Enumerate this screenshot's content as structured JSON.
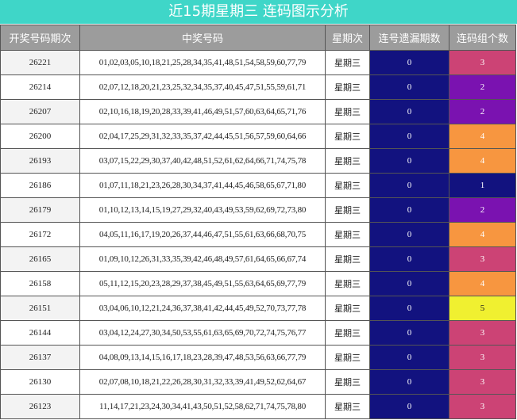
{
  "title": "近15期星期三 连码图示分析",
  "headers": [
    "开奖号码期次",
    "中奖号码",
    "星期次",
    "连号遗漏期数",
    "连码组个数"
  ],
  "rows": [
    {
      "period": "26221",
      "numbers": "01,02,03,05,10,18,21,25,28,34,35,41,48,51,54,58,59,60,77,79",
      "weekday": "星期三",
      "missed": "0",
      "groups": "3"
    },
    {
      "period": "26214",
      "numbers": "02,07,12,18,20,21,23,25,32,34,35,37,40,45,47,51,55,59,61,71",
      "weekday": "星期三",
      "missed": "0",
      "groups": "2"
    },
    {
      "period": "26207",
      "numbers": "02,10,16,18,19,20,28,33,39,41,46,49,51,57,60,63,64,65,71,76",
      "weekday": "星期三",
      "missed": "0",
      "groups": "2"
    },
    {
      "period": "26200",
      "numbers": "02,04,17,25,29,31,32,33,35,37,42,44,45,51,56,57,59,60,64,66",
      "weekday": "星期三",
      "missed": "0",
      "groups": "4"
    },
    {
      "period": "26193",
      "numbers": "03,07,15,22,29,30,37,40,42,48,51,52,61,62,64,66,71,74,75,78",
      "weekday": "星期三",
      "missed": "0",
      "groups": "4"
    },
    {
      "period": "26186",
      "numbers": "01,07,11,18,21,23,26,28,30,34,37,41,44,45,46,58,65,67,71,80",
      "weekday": "星期三",
      "missed": "0",
      "groups": "1"
    },
    {
      "period": "26179",
      "numbers": "01,10,12,13,14,15,19,27,29,32,40,43,49,53,59,62,69,72,73,80",
      "weekday": "星期三",
      "missed": "0",
      "groups": "2"
    },
    {
      "period": "26172",
      "numbers": "04,05,11,16,17,19,20,26,37,44,46,47,51,55,61,63,66,68,70,75",
      "weekday": "星期三",
      "missed": "0",
      "groups": "4"
    },
    {
      "period": "26165",
      "numbers": "01,09,10,12,26,31,33,35,39,42,46,48,49,57,61,64,65,66,67,74",
      "weekday": "星期三",
      "missed": "0",
      "groups": "3"
    },
    {
      "period": "26158",
      "numbers": "05,11,12,15,20,23,28,29,37,38,45,49,51,55,63,64,65,69,77,79",
      "weekday": "星期三",
      "missed": "0",
      "groups": "4"
    },
    {
      "period": "26151",
      "numbers": "03,04,06,10,12,21,24,36,37,38,41,42,44,45,49,52,70,73,77,78",
      "weekday": "星期三",
      "missed": "0",
      "groups": "5"
    },
    {
      "period": "26144",
      "numbers": "03,04,12,24,27,30,34,50,53,55,61,63,65,69,70,72,74,75,76,77",
      "weekday": "星期三",
      "missed": "0",
      "groups": "3"
    },
    {
      "period": "26137",
      "numbers": "04,08,09,13,14,15,16,17,18,23,28,39,47,48,53,56,63,66,77,79",
      "weekday": "星期三",
      "missed": "0",
      "groups": "3"
    },
    {
      "period": "26130",
      "numbers": "02,07,08,10,18,21,22,26,28,30,31,32,33,39,41,49,52,62,64,67",
      "weekday": "星期三",
      "missed": "0",
      "groups": "3"
    },
    {
      "period": "26123",
      "numbers": "11,14,17,21,23,24,30,34,41,43,50,51,52,58,62,71,74,75,78,80",
      "weekday": "星期三",
      "missed": "0",
      "groups": "3"
    }
  ],
  "group_colors": {
    "1": "#12127f",
    "2": "#7a12b0",
    "3": "#cc4375",
    "4": "#f79640",
    "5": "#f0f030"
  }
}
